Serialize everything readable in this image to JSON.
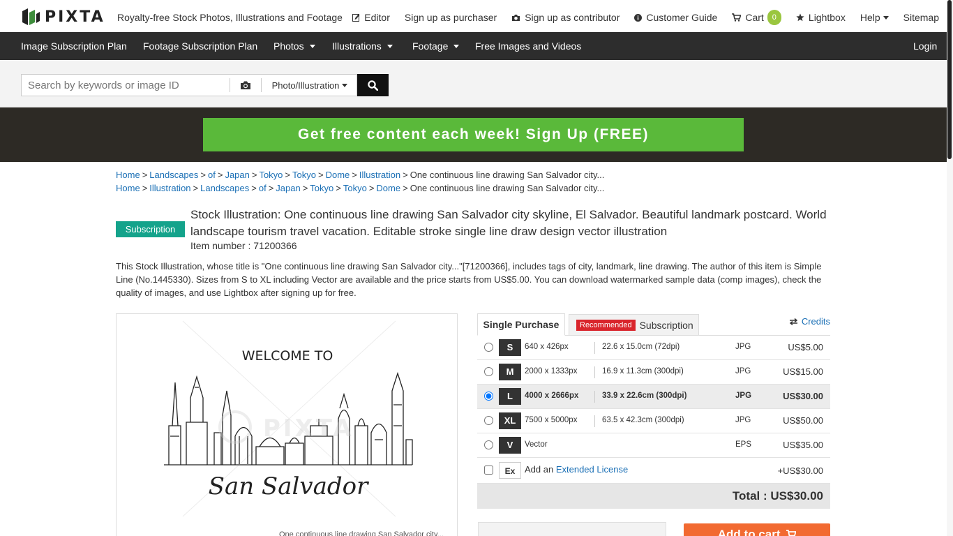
{
  "header": {
    "logo_text": "PIXTA",
    "tagline": "Royalty-free Stock Photos, Illustrations and Footage",
    "nav": {
      "editor": "Editor",
      "signup_purchaser": "Sign up as purchaser",
      "signup_contributor": "Sign up as contributor",
      "customer_guide": "Customer Guide",
      "cart": "Cart",
      "cart_count": "0",
      "lightbox": "Lightbox",
      "help": "Help",
      "sitemap": "Sitemap"
    }
  },
  "main_nav": {
    "image_plan": "Image Subscription Plan",
    "footage_plan": "Footage Subscription Plan",
    "photos": "Photos",
    "illustrations": "Illustrations",
    "footage": "Footage",
    "free": "Free Images and Videos",
    "login": "Login"
  },
  "search": {
    "placeholder": "Search by keywords or image ID",
    "type": "Photo/Illustration"
  },
  "promo": {
    "label": "Get free content each week! Sign Up (FREE)"
  },
  "breadcrumbs": [
    [
      "Home",
      "Landscapes",
      "of",
      "Japan",
      "Tokyo",
      "Tokyo",
      "Dome",
      "Illustration",
      "One continuous line drawing San Salvador city..."
    ],
    [
      "Home",
      "Illustration",
      "Landscapes",
      "of",
      "Japan",
      "Tokyo",
      "Tokyo",
      "Dome",
      "One continuous line drawing San Salvador city..."
    ]
  ],
  "item": {
    "badge": "Subscription",
    "title": "Stock Illustration: One continuous line drawing San Salvador city skyline, El Salvador. Beautiful landmark postcard. World landscape tourism travel vacation. Editable stroke single line draw design vector illustration",
    "item_number": "Item number : 71200366",
    "description": "This Stock Illustration, whose title is \"One continuous line drawing San Salvador city...\"[71200366], includes tags of city, landmark, line drawing. The author of this item is Simple Line (No.1445330). Sizes from S to XL including Vector are available and the price starts from US$5.00. You can download watermarked sample data (comp images), check the quality of images, and use Lightbox after signing up for free."
  },
  "preview": {
    "welcome_text": "WELCOME TO",
    "city_script": "San Salvador",
    "watermark": "PIXTA",
    "caption": "One continuous line drawing San Salvador city..."
  },
  "purchase": {
    "tab_single": "Single Purchase",
    "tab_recommended": "Recommended",
    "tab_subscription": "Subscription",
    "credits": "Credits",
    "sizes": [
      {
        "code": "S",
        "px": "640 x 426px",
        "cm": "22.6 x 15.0cm (72dpi)",
        "format": "JPG",
        "price": "US$5.00",
        "selected": false
      },
      {
        "code": "M",
        "px": "2000 x 1333px",
        "cm": "16.9 x 11.3cm (300dpi)",
        "format": "JPG",
        "price": "US$15.00",
        "selected": false
      },
      {
        "code": "L",
        "px": "4000 x 2666px",
        "cm": "33.9 x 22.6cm (300dpi)",
        "format": "JPG",
        "price": "US$30.00",
        "selected": true
      },
      {
        "code": "XL",
        "px": "7500 x 5000px",
        "cm": "63.5 x 42.3cm (300dpi)",
        "format": "JPG",
        "price": "US$50.00",
        "selected": false
      },
      {
        "code": "V",
        "px": "Vector",
        "cm": "",
        "format": "EPS",
        "price": "US$35.00",
        "selected": false
      }
    ],
    "extended": {
      "code": "Ex",
      "prefix": "Add an",
      "link": "Extended License",
      "price": "+US$30.00"
    },
    "total": "Total : US$30.00",
    "add_to_cart": "Add to cart"
  },
  "colors": {
    "promo_green": "#5ab93a",
    "subscription_teal": "#14a38b",
    "recommended_red": "#d9252c",
    "cart_orange": "#f26a31",
    "cart_badge": "#9ac63f",
    "nav_dark": "#2d2d2d"
  }
}
